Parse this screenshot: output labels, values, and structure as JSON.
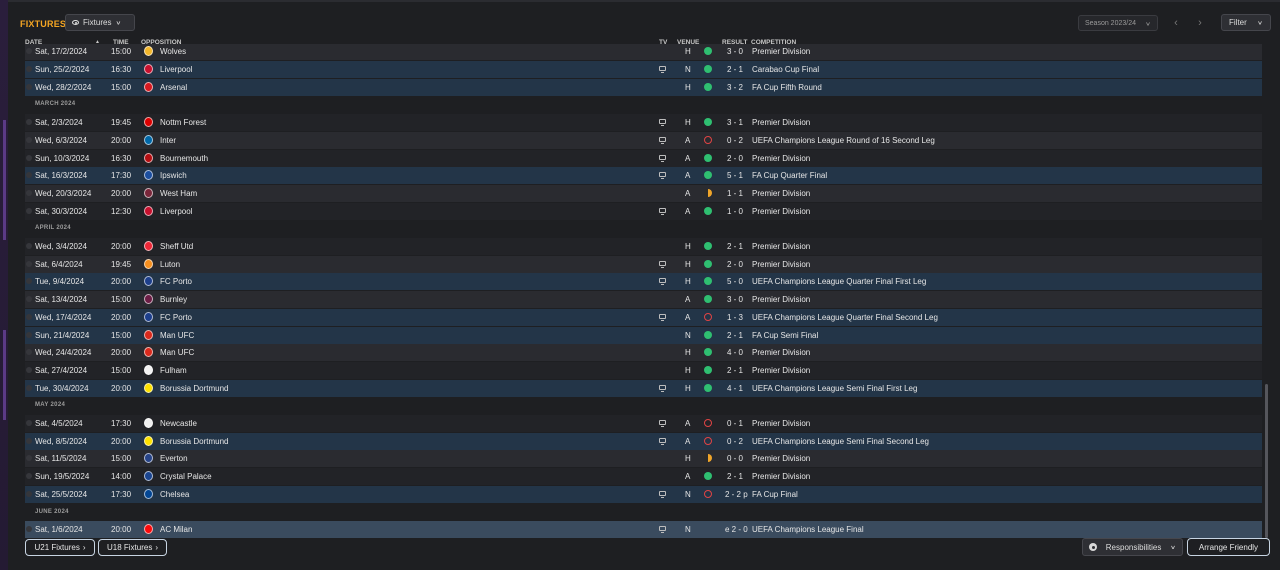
{
  "header": {
    "title": "FIXTURES",
    "view_label": "Fixtures",
    "season_label": "Season 2023/24",
    "filter_label": "Filter"
  },
  "columns": {
    "date": "DATE",
    "time": "TIME",
    "opposition": "OPPOSITION",
    "tv": "TV",
    "venue": "VENUE",
    "result": "RESULT",
    "competition": "COMPETITION"
  },
  "rows": [
    {
      "kind": "match",
      "date": "Sat, 17/2/2024",
      "time": "15:00",
      "opp": "Wolves",
      "tv": false,
      "venue": "H",
      "outcome": "win",
      "result": "3 - 0",
      "comp": "Premier Division",
      "style": "alt",
      "badge": "#f3b62a"
    },
    {
      "kind": "match",
      "date": "Sun, 25/2/2024",
      "time": "16:30",
      "opp": "Liverpool",
      "tv": true,
      "venue": "N",
      "outcome": "win",
      "result": "2 - 1",
      "comp": "Carabao Cup Final",
      "style": "hl",
      "badge": "#c8102e"
    },
    {
      "kind": "match",
      "date": "Wed, 28/2/2024",
      "time": "15:00",
      "opp": "Arsenal",
      "tv": false,
      "venue": "H",
      "outcome": "win",
      "result": "3 - 2",
      "comp": "FA Cup Fifth Round",
      "style": "hl",
      "badge": "#d71920"
    },
    {
      "kind": "month",
      "label": "MARCH 2024"
    },
    {
      "kind": "match",
      "date": "Sat, 2/3/2024",
      "time": "19:45",
      "opp": "Nottm Forest",
      "tv": true,
      "venue": "H",
      "outcome": "win",
      "result": "3 - 1",
      "comp": "Premier Division",
      "style": "base",
      "badge": "#dd0000"
    },
    {
      "kind": "match",
      "date": "Wed, 6/3/2024",
      "time": "20:00",
      "opp": "Inter",
      "tv": true,
      "venue": "A",
      "outcome": "loss",
      "result": "0 - 2",
      "comp": "UEFA Champions League Round of 16 Second Leg",
      "style": "alt",
      "badge": "#0068a8"
    },
    {
      "kind": "match",
      "date": "Sun, 10/3/2024",
      "time": "16:30",
      "opp": "Bournemouth",
      "tv": true,
      "venue": "A",
      "outcome": "win",
      "result": "2 - 0",
      "comp": "Premier Division",
      "style": "base",
      "badge": "#b50e12"
    },
    {
      "kind": "match",
      "date": "Sat, 16/3/2024",
      "time": "17:30",
      "opp": "Ipswich",
      "tv": true,
      "venue": "A",
      "outcome": "win",
      "result": "5 - 1",
      "comp": "FA Cup Quarter Final",
      "style": "hl",
      "badge": "#1c4fa0"
    },
    {
      "kind": "match",
      "date": "Wed, 20/3/2024",
      "time": "20:00",
      "opp": "West Ham",
      "tv": false,
      "venue": "A",
      "outcome": "draw",
      "result": "1 - 1",
      "comp": "Premier Division",
      "style": "alt",
      "badge": "#7a263a"
    },
    {
      "kind": "match",
      "date": "Sat, 30/3/2024",
      "time": "12:30",
      "opp": "Liverpool",
      "tv": true,
      "venue": "A",
      "outcome": "win",
      "result": "1 - 0",
      "comp": "Premier Division",
      "style": "base",
      "badge": "#c8102e"
    },
    {
      "kind": "month",
      "label": "APRIL 2024"
    },
    {
      "kind": "match",
      "date": "Wed, 3/4/2024",
      "time": "20:00",
      "opp": "Sheff Utd",
      "tv": false,
      "venue": "H",
      "outcome": "win",
      "result": "2 - 1",
      "comp": "Premier Division",
      "style": "base",
      "badge": "#ee2737"
    },
    {
      "kind": "match",
      "date": "Sat, 6/4/2024",
      "time": "19:45",
      "opp": "Luton",
      "tv": true,
      "venue": "H",
      "outcome": "win",
      "result": "2 - 0",
      "comp": "Premier Division",
      "style": "alt",
      "badge": "#f78f1e"
    },
    {
      "kind": "match",
      "date": "Tue, 9/4/2024",
      "time": "20:00",
      "opp": "FC Porto",
      "tv": true,
      "venue": "H",
      "outcome": "win",
      "result": "5 - 0",
      "comp": "UEFA Champions League Quarter Final First Leg",
      "style": "hl",
      "badge": "#1d3f8c"
    },
    {
      "kind": "match",
      "date": "Sat, 13/4/2024",
      "time": "15:00",
      "opp": "Burnley",
      "tv": false,
      "venue": "A",
      "outcome": "win",
      "result": "3 - 0",
      "comp": "Premier Division",
      "style": "alt",
      "badge": "#6c1d45"
    },
    {
      "kind": "match",
      "date": "Wed, 17/4/2024",
      "time": "20:00",
      "opp": "FC Porto",
      "tv": true,
      "venue": "A",
      "outcome": "loss",
      "result": "1 - 3",
      "comp": "UEFA Champions League Quarter Final Second Leg",
      "style": "hl",
      "badge": "#1d3f8c"
    },
    {
      "kind": "match",
      "date": "Sun, 21/4/2024",
      "time": "15:00",
      "opp": "Man UFC",
      "tv": false,
      "venue": "N",
      "outcome": "win",
      "result": "2 - 1",
      "comp": "FA Cup Semi Final",
      "style": "hl",
      "badge": "#da291c"
    },
    {
      "kind": "match",
      "date": "Wed, 24/4/2024",
      "time": "20:00",
      "opp": "Man UFC",
      "tv": false,
      "venue": "H",
      "outcome": "win",
      "result": "4 - 0",
      "comp": "Premier Division",
      "style": "alt",
      "badge": "#da291c"
    },
    {
      "kind": "match",
      "date": "Sat, 27/4/2024",
      "time": "15:00",
      "opp": "Fulham",
      "tv": false,
      "venue": "H",
      "outcome": "win",
      "result": "2 - 1",
      "comp": "Premier Division",
      "style": "base",
      "badge": "#f2f2f2"
    },
    {
      "kind": "match",
      "date": "Tue, 30/4/2024",
      "time": "20:00",
      "opp": "Borussia Dortmund",
      "tv": true,
      "venue": "H",
      "outcome": "win",
      "result": "4 - 1",
      "comp": "UEFA Champions League Semi Final First Leg",
      "style": "hl",
      "badge": "#fde100"
    },
    {
      "kind": "month",
      "label": "MAY 2024"
    },
    {
      "kind": "match",
      "date": "Sat, 4/5/2024",
      "time": "17:30",
      "opp": "Newcastle",
      "tv": true,
      "venue": "A",
      "outcome": "loss",
      "result": "0 - 1",
      "comp": "Premier Division",
      "style": "base",
      "badge": "#f0f0f0"
    },
    {
      "kind": "match",
      "date": "Wed, 8/5/2024",
      "time": "20:00",
      "opp": "Borussia Dortmund",
      "tv": true,
      "venue": "A",
      "outcome": "loss",
      "result": "0 - 2",
      "comp": "UEFA Champions League Semi Final Second Leg",
      "style": "hl",
      "badge": "#fde100"
    },
    {
      "kind": "match",
      "date": "Sat, 11/5/2024",
      "time": "15:00",
      "opp": "Everton",
      "tv": false,
      "venue": "H",
      "outcome": "draw",
      "result": "0 - 0",
      "comp": "Premier Division",
      "style": "alt",
      "badge": "#274488"
    },
    {
      "kind": "match",
      "date": "Sun, 19/5/2024",
      "time": "14:00",
      "opp": "Crystal Palace",
      "tv": false,
      "venue": "A",
      "outcome": "win",
      "result": "2 - 1",
      "comp": "Premier Division",
      "style": "base",
      "badge": "#1b458f"
    },
    {
      "kind": "match",
      "date": "Sat, 25/5/2024",
      "time": "17:30",
      "opp": "Chelsea",
      "tv": true,
      "venue": "N",
      "outcome": "loss",
      "result": "2 - 2 p",
      "comp": "FA Cup Final",
      "style": "hl",
      "badge": "#034694"
    },
    {
      "kind": "month",
      "label": "JUNE 2024"
    },
    {
      "kind": "match",
      "date": "Sat, 1/6/2024",
      "time": "20:00",
      "opp": "AC Milan",
      "tv": true,
      "venue": "N",
      "outcome": "none",
      "result": "e 2 - 0",
      "comp": "UEFA Champions League Final",
      "style": "sel",
      "badge": "#fb090b"
    }
  ],
  "footer": {
    "u21_label": "U21 Fixtures",
    "u18_label": "U18 Fixtures",
    "responsibilities_label": "Responsibilities",
    "arrange_label": "Arrange Friendly"
  }
}
